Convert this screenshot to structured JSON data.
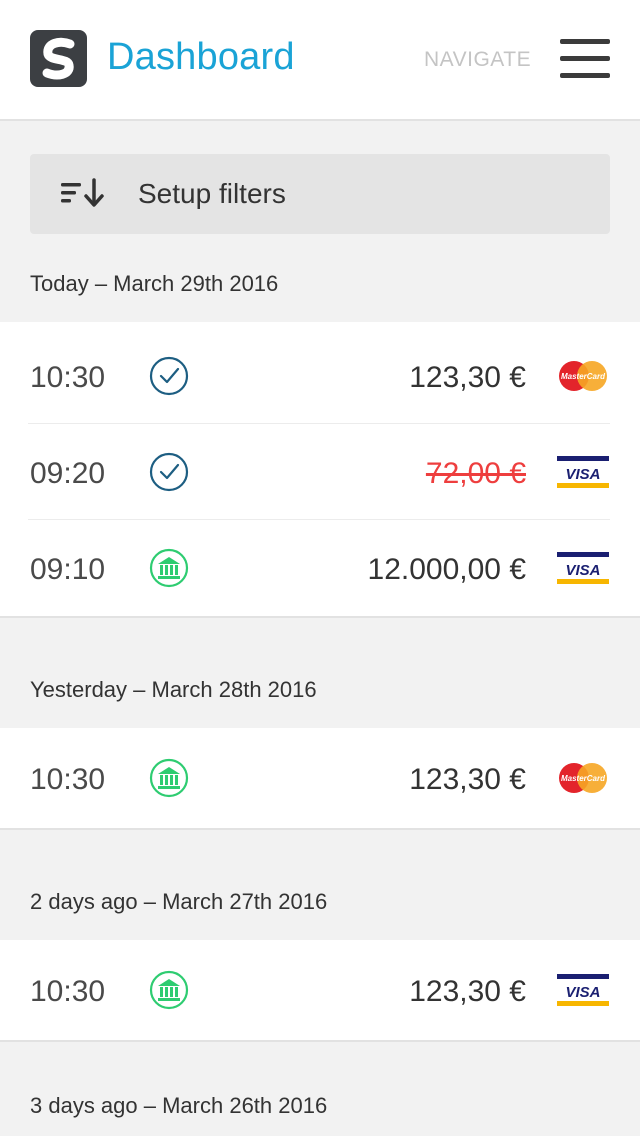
{
  "header": {
    "logo_icon": "app-logo-icon",
    "title": "Dashboard",
    "navigate_label": "NAVIGATE",
    "menu_icon": "hamburger-menu-icon"
  },
  "filters": {
    "icon": "sort-icon",
    "label": "Setup filters"
  },
  "colors": {
    "brand": "#1aa3d6",
    "confirmed": "#1d5e82",
    "bank": "#2ecc71",
    "cancelled": "#ee3e3e"
  },
  "sections": [
    {
      "header": "Today – March 29th 2016",
      "transactions": [
        {
          "time": "10:30",
          "status": "check-circle-icon",
          "amount": "123,30 €",
          "cancelled": false,
          "card": "mastercard-icon"
        },
        {
          "time": "09:20",
          "status": "check-circle-icon",
          "amount": "72,00 €",
          "cancelled": true,
          "card": "visa-icon"
        },
        {
          "time": "09:10",
          "status": "bank-icon",
          "amount": "12.000,00 €",
          "cancelled": false,
          "card": "visa-icon"
        }
      ]
    },
    {
      "header": "Yesterday – March 28th 2016",
      "transactions": [
        {
          "time": "10:30",
          "status": "bank-icon",
          "amount": "123,30 €",
          "cancelled": false,
          "card": "mastercard-icon"
        }
      ]
    },
    {
      "header": "2 days ago – March 27th 2016",
      "transactions": [
        {
          "time": "10:30",
          "status": "bank-icon",
          "amount": "123,30 €",
          "cancelled": false,
          "card": "visa-icon"
        }
      ]
    },
    {
      "header": "3 days ago – March 26th 2016",
      "transactions": []
    }
  ]
}
